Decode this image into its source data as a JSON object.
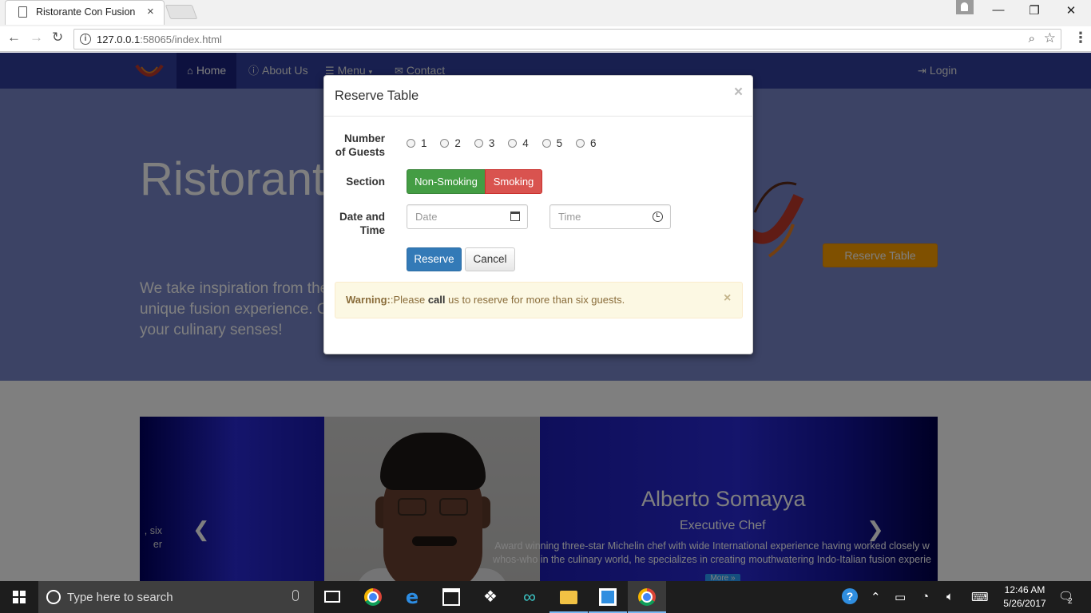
{
  "browser": {
    "tab_title": "Ristorante Con Fusion",
    "tab_close": "×",
    "url_host": "127.0.0.1",
    "url_path": ":58065/index.html",
    "window_controls": [
      "—",
      "❐",
      "✕"
    ]
  },
  "navbar": {
    "items": [
      {
        "label": "Home",
        "icon": "home-icon"
      },
      {
        "label": "About Us",
        "icon": "info-icon"
      },
      {
        "label": "Menu",
        "icon": "list-icon"
      },
      {
        "label": "Contact",
        "icon": "envelope-icon"
      }
    ],
    "login": "Login",
    "colors": {
      "navbar": "#303F9F",
      "active": "#1A237E"
    }
  },
  "jumbotron": {
    "title": "Ristorante con Fusion",
    "text": "We take inspiration from the World's best cuisines, and create a unique fusion experience. Our lipsmacking creations will tickle your culinary senses!",
    "reserve_button": "Reserve Table"
  },
  "carousel": {
    "caption_left_1": ", six",
    "caption_left_2": "er",
    "name": "Alberto Somayya",
    "role": "Executive Chef",
    "description_1": "Award winning three-star Michelin chef with wide International experience having worked closely w",
    "description_2": "whos-who in the culinary world, he specializes in creating mouthwatering Indo-Italian fusion experie",
    "more_button": "More »"
  },
  "modal": {
    "title": "Reserve Table",
    "close": "×",
    "guests_label_1": "Number",
    "guests_label_2": "of Guests",
    "guest_options": [
      "1",
      "2",
      "3",
      "4",
      "5",
      "6"
    ],
    "section_label": "Section",
    "section_options": [
      "Non-Smoking",
      "Smoking"
    ],
    "datetime_label_1": "Date and",
    "datetime_label_2": "Time",
    "date_placeholder": "Date",
    "time_placeholder": "Time",
    "reserve_button": "Reserve",
    "cancel_button": "Cancel",
    "alert_strong": "Warning:",
    "alert_text_1": ":Please ",
    "alert_call": "call",
    "alert_text_2": " us to reserve for more than six guests.",
    "alert_close": "×",
    "colors": {
      "non_smoking": "#449D44",
      "smoking": "#D9534F",
      "primary": "#337AB7",
      "warning_bg": "#FCF8E3"
    }
  },
  "taskbar": {
    "search_placeholder": "Type here to search",
    "time": "12:46 AM",
    "date": "5/26/2017",
    "notification_count": "2"
  }
}
